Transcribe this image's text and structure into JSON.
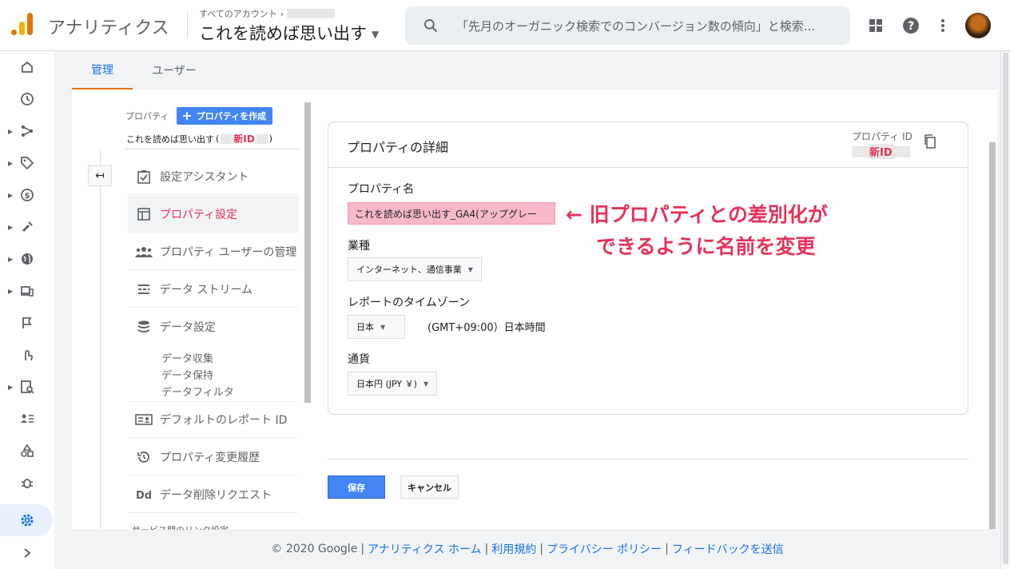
{
  "header": {
    "app_title": "アナリティクス",
    "account_crumb": "すべてのアカウント",
    "property_name": "これを読めば思い出す",
    "search_placeholder": "「先月のオーガニック検索でのコンバージョン数の傾向」と検索..."
  },
  "tabs": [
    {
      "label": "管理",
      "active": true
    },
    {
      "label": "ユーザー",
      "active": false
    }
  ],
  "property_column": {
    "heading": "プロパティ",
    "create_button": "プロパティを作成",
    "current_property": "これを読めば思い出す",
    "new_id_tag": "新ID",
    "menu": [
      {
        "label": "設定アシスタント",
        "icon": "checklist-icon"
      },
      {
        "label": "プロパティ設定",
        "icon": "layout-icon",
        "active": true
      },
      {
        "label": "プロパティ ユーザーの管理",
        "icon": "users-icon"
      },
      {
        "label": "データ ストリーム",
        "icon": "streams-icon"
      },
      {
        "label": "データ設定",
        "icon": "database-icon"
      },
      {
        "label": "デフォルトのレポート ID",
        "icon": "id-card-icon"
      },
      {
        "label": "プロパティ変更履歴",
        "icon": "history-icon"
      },
      {
        "label": "データ削除リクエスト",
        "icon": "dd-icon"
      }
    ],
    "data_settings_sub": [
      "データ収集",
      "データ保持",
      "データフィルタ"
    ],
    "cut_off_item": "サービス間のリンク設定"
  },
  "details": {
    "title": "プロパティの詳細",
    "property_id_label": "プロパティ ID",
    "property_id_value": "新ID",
    "property_name_label": "プロパティ名",
    "property_name_value": "これを読めば思い出す_GA4(アップグレー",
    "industry_label": "業種",
    "industry_value": "インターネット、通信事業",
    "timezone_label": "レポートのタイムゾーン",
    "timezone_country": "日本",
    "timezone_text": "(GMT+09:00）日本時間",
    "currency_label": "通貨",
    "currency_value": "日本円 (JPY ￥)"
  },
  "annotation": {
    "line1": "← 旧プロパティとの差別化が",
    "line2": "できるように名前を変更"
  },
  "actions": {
    "save": "保存",
    "cancel": "キャンセル"
  },
  "footer": {
    "copyright": "© 2020 Google",
    "links": [
      "アナリティクス ホーム",
      "利用規約",
      "プライバシー ポリシー",
      "フィードバックを送信"
    ]
  },
  "colors": {
    "accent_blue": "#1a73e8",
    "tab_underline": "#e37400",
    "annotation_pink": "#e6325a",
    "highlight_input": "#f7b8c9"
  }
}
